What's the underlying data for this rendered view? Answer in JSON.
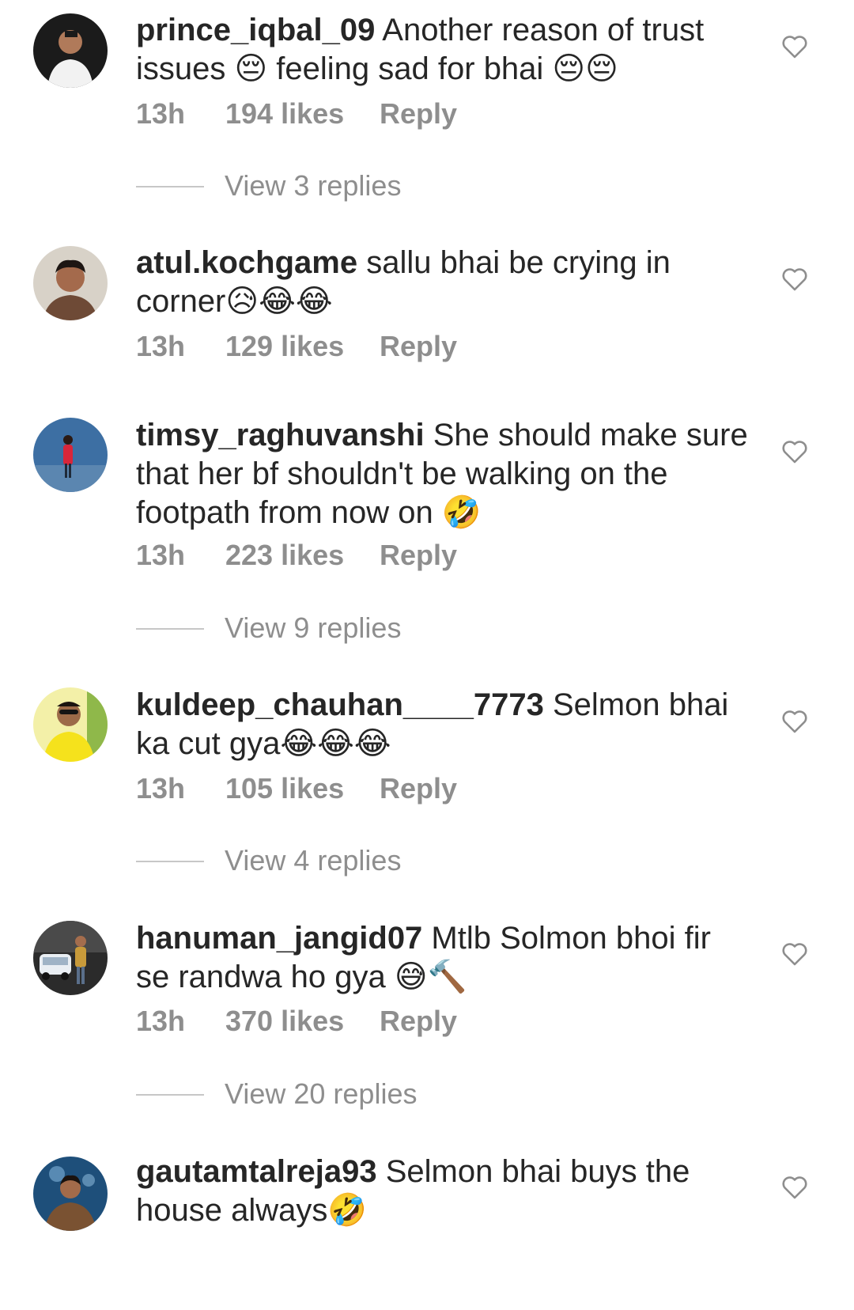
{
  "comments": [
    {
      "username": "prince_iqbal_09",
      "text": " Another reason of trust issues 😔 feeling sad for bhai 😔😔",
      "time": "13h",
      "likes": "194 likes",
      "reply": "Reply",
      "view_replies": "View 3 replies"
    },
    {
      "username": "atul.kochgame",
      "text": " sallu bhai be crying in corner😥😂😂",
      "time": "13h",
      "likes": "129 likes",
      "reply": "Reply"
    },
    {
      "username": "timsy_raghuvanshi",
      "text": " She should make sure that her bf shouldn't be walking on the footpath from now on 🤣",
      "time": "13h",
      "likes": "223 likes",
      "reply": "Reply",
      "view_replies": "View 9 replies"
    },
    {
      "username": "kuldeep_chauhan____7773",
      "text": " Selmon bhai ka cut gya😂😂😂",
      "time": "13h",
      "likes": "105 likes",
      "reply": "Reply",
      "view_replies": "View 4 replies"
    },
    {
      "username": "hanuman_jangid07",
      "text": " Mtlb Solmon bhoi fir se randwa ho gya 😅🔨",
      "time": "13h",
      "likes": "370 likes",
      "reply": "Reply",
      "view_replies": "View 20 replies"
    },
    {
      "username": "gautamtalreja93",
      "text": " Selmon bhai buys the house always🤣"
    }
  ],
  "icons": {
    "heart": "heart-outline-icon",
    "avatar": "avatar"
  },
  "colors": {
    "text": "#262626",
    "meta": "#8e8e8e",
    "divider": "#c7c7c7"
  }
}
